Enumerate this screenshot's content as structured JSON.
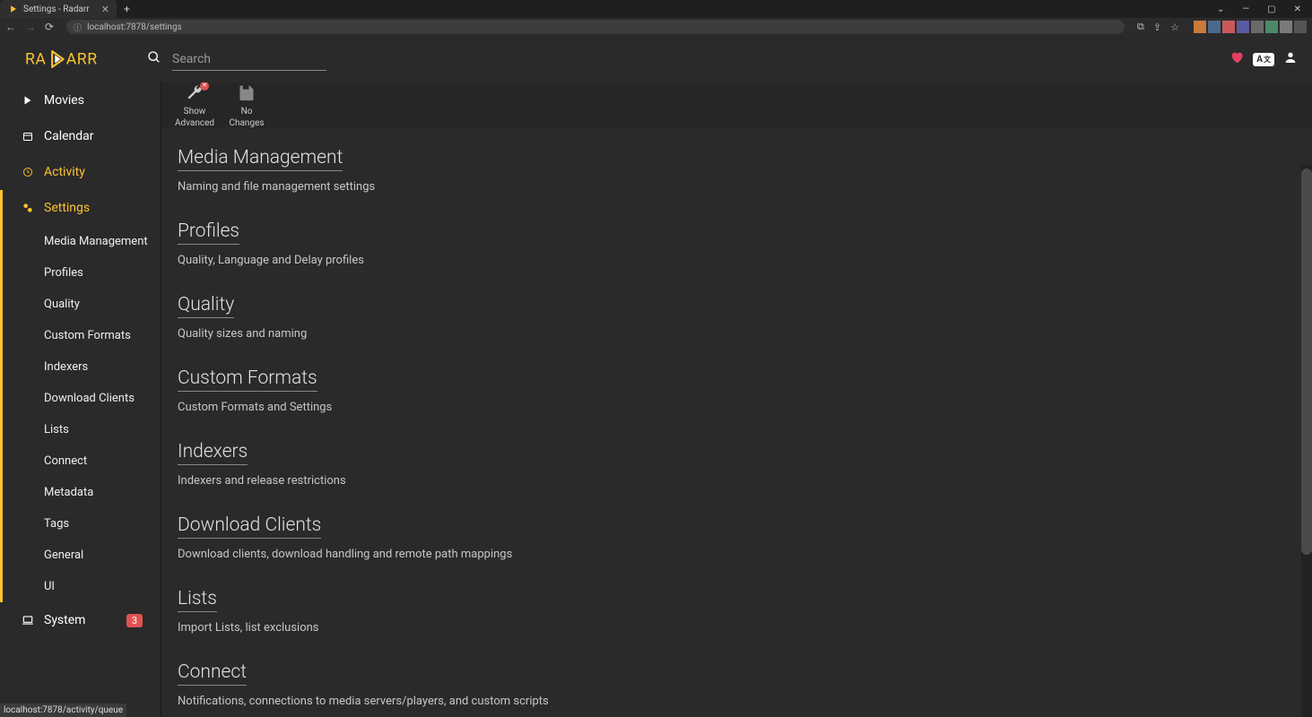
{
  "window": {
    "tab_title": "Settings - Radarr",
    "url": "localhost:7878/settings"
  },
  "header": {
    "search_placeholder": "Search"
  },
  "sidebar": {
    "movies": "Movies",
    "calendar": "Calendar",
    "activity": "Activity",
    "settings": "Settings",
    "system": "System",
    "system_badge": "3",
    "subitems": [
      "Media Management",
      "Profiles",
      "Quality",
      "Custom Formats",
      "Indexers",
      "Download Clients",
      "Lists",
      "Connect",
      "Metadata",
      "Tags",
      "General",
      "UI"
    ]
  },
  "toolbar": {
    "show_advanced_l1": "Show",
    "show_advanced_l2": "Advanced",
    "no_changes_l1": "No",
    "no_changes_l2": "Changes"
  },
  "sections": [
    {
      "title": "Media Management",
      "desc": "Naming and file management settings"
    },
    {
      "title": "Profiles",
      "desc": "Quality, Language and Delay profiles"
    },
    {
      "title": "Quality",
      "desc": "Quality sizes and naming"
    },
    {
      "title": "Custom Formats",
      "desc": "Custom Formats and Settings"
    },
    {
      "title": "Indexers",
      "desc": "Indexers and release restrictions"
    },
    {
      "title": "Download Clients",
      "desc": "Download clients, download handling and remote path mappings"
    },
    {
      "title": "Lists",
      "desc": "Import Lists, list exclusions"
    },
    {
      "title": "Connect",
      "desc": "Notifications, connections to media servers/players, and custom scripts"
    }
  ],
  "status_bar": "localhost:7878/activity/queue",
  "colors": {
    "accent": "#ffc230",
    "danger": "#e05252"
  }
}
